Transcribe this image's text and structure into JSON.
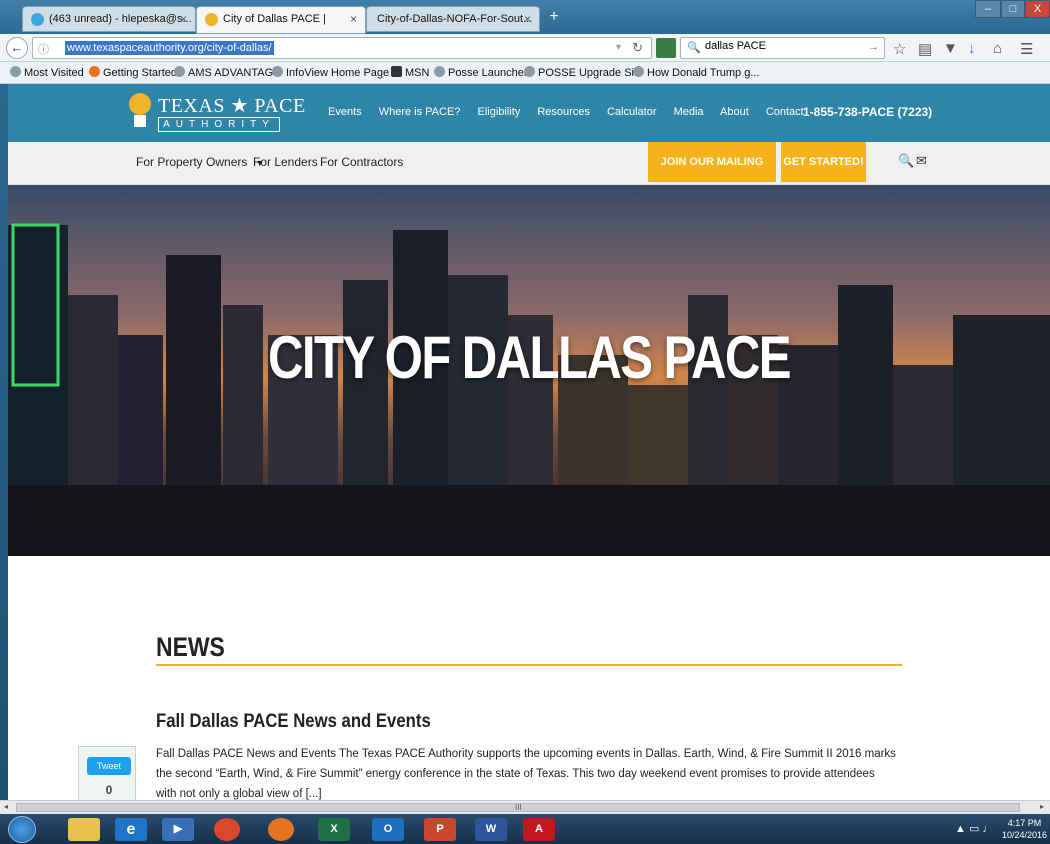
{
  "browser": {
    "tabs": [
      {
        "label": "(463 unread) - hlepeska@s...",
        "close": "×",
        "icon_color": "#3ea8e0"
      },
      {
        "label": "City of Dallas PACE |",
        "close": "×",
        "icon_color": "#f2b32a"
      },
      {
        "label": "City-of-Dallas-NOFA-For-Sout...",
        "close": "×",
        "icon_color": "#cc3333"
      }
    ],
    "new_tab": "+",
    "window_controls": {
      "minimize": "–",
      "maximize": "□",
      "close": "X"
    },
    "url": "www.texaspaceauthority.org/city-of-dallas/",
    "info_icon": "ⓘ",
    "search_value": "dallas PACE",
    "bookmarks": [
      "Most Visited",
      "Getting Started",
      "AMS ADVANTAGE",
      "InfoView Home Page",
      "MSN",
      "Posse Launcher",
      "POSSE Upgrade Site",
      "How Donald Trump g..."
    ]
  },
  "site": {
    "logo": {
      "title": "TEXAS ★ PACE",
      "subtitle": "AUTHORITY"
    },
    "top_nav": [
      "Events",
      "Where is PACE?",
      "Eligibility",
      "Resources",
      "Calculator",
      "Media",
      "About",
      "Contact"
    ],
    "phone": "1-855-738-PACE (7223)",
    "sub_nav": {
      "property_owners": "For Property Owners",
      "lenders": "For Lenders",
      "contractors": "For Contractors"
    },
    "mailing_list_button": "JOIN OUR MAILING LIST",
    "get_started_button": "GET STARTED!",
    "hero_title": "CITY OF DALLAS PACE",
    "news_heading": "NEWS",
    "article": {
      "title": "Fall Dallas PACE News and Events",
      "text": "Fall Dallas PACE News and Events The Texas PACE Authority supports the upcoming events in Dallas. Earth, Wind, & Fire Summit II 2016 marks the second “Earth, Wind, & Fire Summit” energy conference in the state of Texas. This two day weekend event promises to provide attendees with not only a global view of [...]"
    },
    "tweet": {
      "label": "Tweet",
      "count": "0"
    }
  },
  "scrollbar": {
    "left_arrow": "◂",
    "right_arrow": "▸",
    "grip": "III"
  },
  "taskbar": {
    "apps": [
      {
        "name": "file-explorer",
        "label": "",
        "color": "#e7c14a"
      },
      {
        "name": "internet-explorer",
        "label": "e",
        "color": "#1c75c9"
      },
      {
        "name": "media",
        "label": "▶",
        "color": "#3a6fb5"
      },
      {
        "name": "chrome",
        "label": "",
        "color": "#d9482b"
      },
      {
        "name": "firefox",
        "label": "",
        "color": "#e6731f"
      },
      {
        "name": "excel",
        "label": "X",
        "color": "#1e7145"
      },
      {
        "name": "outlook",
        "label": "O",
        "color": "#1f6fbf"
      },
      {
        "name": "powerpoint",
        "label": "P",
        "color": "#c8462b"
      },
      {
        "name": "word",
        "label": "W",
        "color": "#2b579a"
      },
      {
        "name": "acrobat",
        "label": "A",
        "color": "#c4161c"
      }
    ],
    "time": "4:17 PM",
    "date": "10/24/2016"
  }
}
